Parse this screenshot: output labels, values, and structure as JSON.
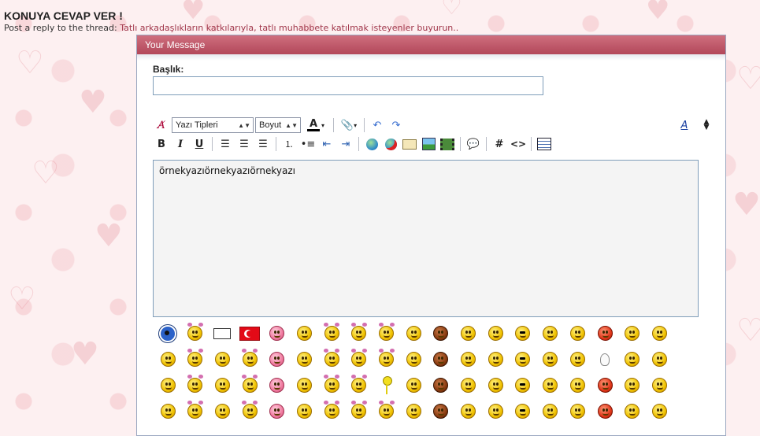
{
  "page": {
    "title": "KONUYA CEVAP VER !",
    "subtitle_prefix": "Post a reply to the thread:",
    "thread_link": "Tatlı arkadaşlıkların katkılarıyla, tatlı muhabbete katılmak isteyenler buyurun.."
  },
  "panel": {
    "header": "Your Message",
    "title_label": "Başlık:",
    "title_value": ""
  },
  "toolbar": {
    "font_select": "Yazı Tipleri",
    "size_select": "Boyut",
    "buttons_row1": [
      "remove-format",
      "font-color",
      "attach",
      "undo",
      "redo"
    ],
    "buttons_row2": [
      "bold",
      "italic",
      "underline",
      "align-left",
      "align-center",
      "align-right",
      "ordered-list",
      "unordered-list",
      "outdent",
      "indent",
      "insert-link",
      "remove-link",
      "insert-email",
      "insert-image",
      "insert-video",
      "quote",
      "wrap-code-hash",
      "wrap-html",
      "insert-table"
    ],
    "bold_label": "B",
    "italic_label": "I",
    "underline_label": "U",
    "hash_label": "#",
    "html_label": "<>"
  },
  "editor": {
    "content": "örnekyazıörnekyazıörnekyazı"
  },
  "colors": {
    "panel_header": "#b84a5c",
    "link": "#a0364a",
    "editor_bg": "#f4f4f4",
    "input_border": "#7f9db9"
  },
  "smilies_count": 76
}
